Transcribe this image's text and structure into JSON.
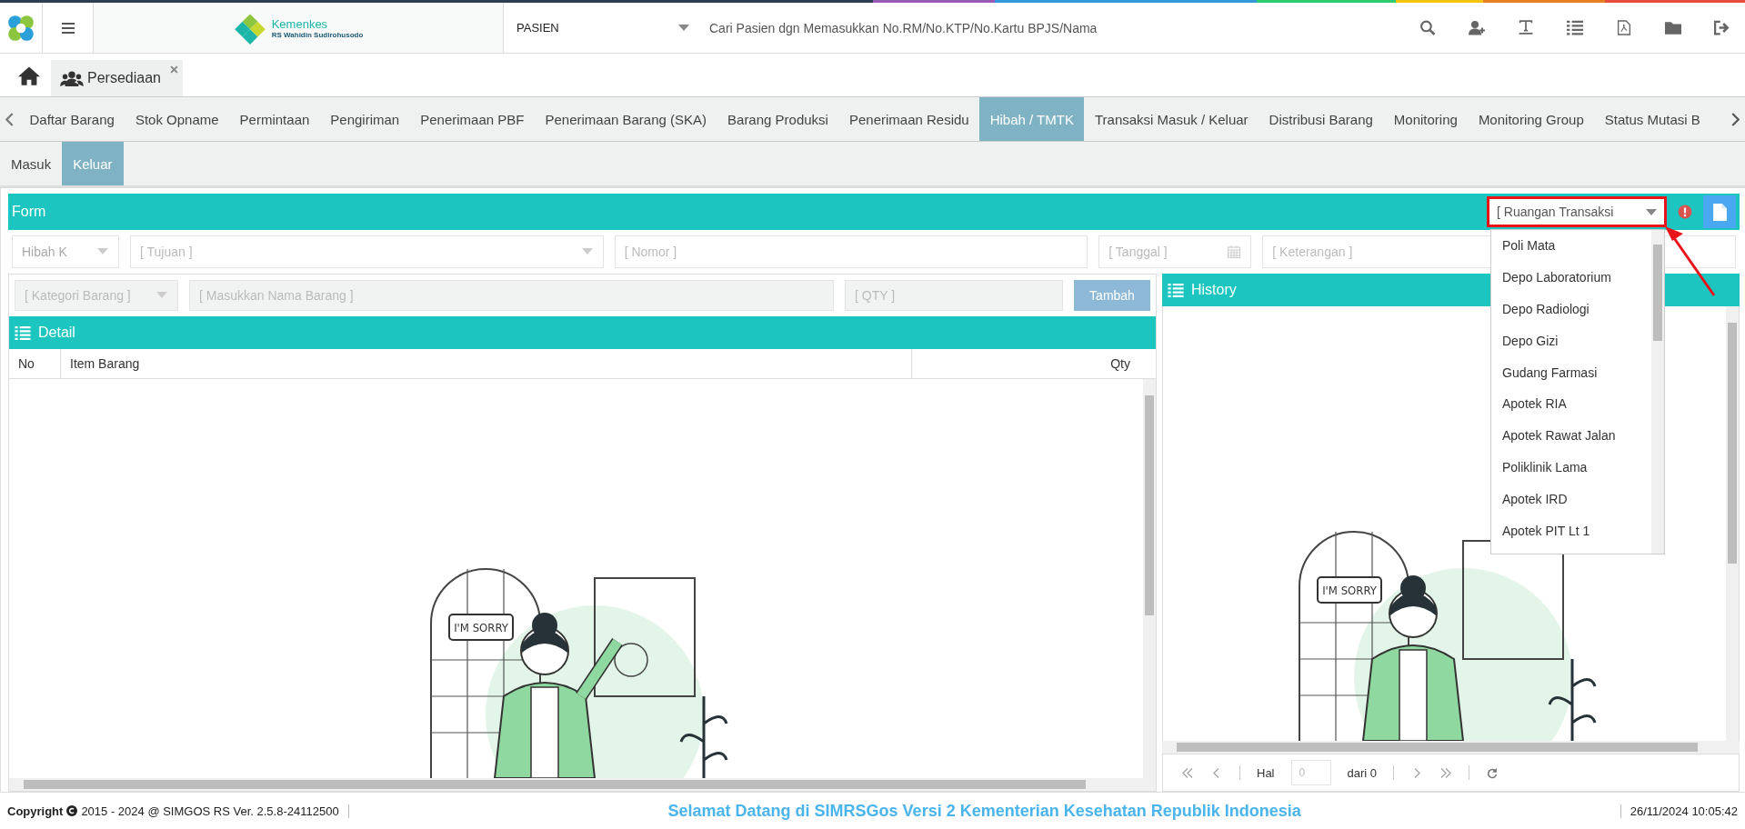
{
  "header": {
    "logo_title": "Kemenkes",
    "logo_subtitle": "RS Wahidin Sudirohusodo",
    "search_type": "PASIEN",
    "search_placeholder": "Cari Pasien dgn Memasukkan No.RM/No.KTP/No.Kartu BPJS/Nama"
  },
  "open_tabs": [
    {
      "label": "Persediaan",
      "selected": true
    }
  ],
  "menu_tabs": [
    {
      "label": "Daftar Barang",
      "selected": false
    },
    {
      "label": "Stok Opname",
      "selected": false
    },
    {
      "label": "Permintaan",
      "selected": false
    },
    {
      "label": "Pengiriman",
      "selected": false
    },
    {
      "label": "Penerimaan PBF",
      "selected": false
    },
    {
      "label": "Penerimaan Barang (SKA)",
      "selected": false
    },
    {
      "label": "Barang Produksi",
      "selected": false
    },
    {
      "label": "Penerimaan Residu",
      "selected": false
    },
    {
      "label": "Hibah / TMTK",
      "selected": true
    },
    {
      "label": "Transaksi Masuk / Keluar",
      "selected": false
    },
    {
      "label": "Distribusi Barang",
      "selected": false
    },
    {
      "label": "Monitoring",
      "selected": false
    },
    {
      "label": "Monitoring Group",
      "selected": false
    },
    {
      "label": "Status Mutasi B",
      "selected": false
    }
  ],
  "sub_tabs": [
    {
      "label": "Masuk",
      "selected": false
    },
    {
      "label": "Keluar",
      "selected": true
    }
  ],
  "form": {
    "title": "Form",
    "room_select": {
      "placeholder": "[ Ruangan Transaksi",
      "expanded": true,
      "highlighted": true,
      "options": [
        "Poli Mata",
        "Depo Laboratorium",
        "Depo Radiologi",
        "Depo Gizi",
        "Gudang Farmasi",
        "Apotek RIA",
        "Apotek Rawat Jalan",
        "Poliklinik Lama",
        "Apotek IRD",
        "Apotek PIT Lt 1"
      ]
    },
    "fields": [
      {
        "kind": "select",
        "value": "Hibah K"
      },
      {
        "kind": "select",
        "placeholder": "[ Tujuan ]"
      },
      {
        "kind": "text",
        "placeholder": "[ Nomor ]"
      },
      {
        "kind": "date",
        "placeholder": "[ Tanggal ]"
      },
      {
        "kind": "text",
        "placeholder": "[ Keterangan ]"
      }
    ],
    "item_fields": [
      {
        "kind": "select",
        "placeholder": "[ Kategori Barang ]"
      },
      {
        "kind": "text",
        "placeholder": "[ Masukkan Nama Barang ]"
      },
      {
        "kind": "text",
        "placeholder": "[ QTY ]"
      }
    ],
    "add_button": "Tambah"
  },
  "detail": {
    "title": "Detail",
    "columns": [
      "No",
      "Item Barang",
      "Qty"
    ],
    "illustration_text": "I'M SORRY"
  },
  "history": {
    "title": "History",
    "illustration_text": "I'M SORRY",
    "pager": {
      "page_label": "Hal",
      "page_value": "0",
      "total": "dari 0"
    }
  },
  "footer": {
    "copyright_label": "Copyright",
    "copyright_text": "2015 - 2024 @ SIMGOS RS Ver. 2.5.8-24112500",
    "welcome": "Selamat Datang di SIMRSGos Versi 2 Kementerian Kesehatan Republik Indonesia",
    "datetime": "26/11/2024 10:05:42"
  }
}
